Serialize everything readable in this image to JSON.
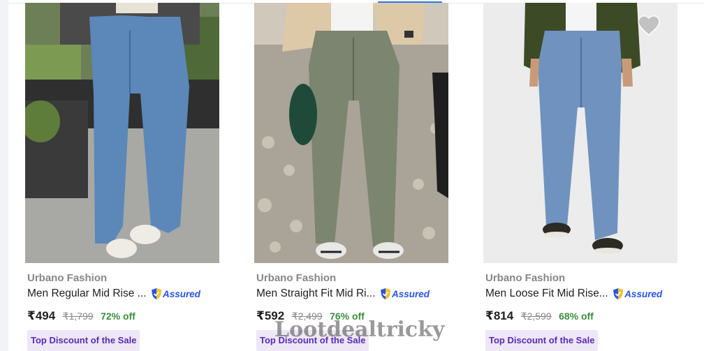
{
  "products": [
    {
      "brand": "Urbano Fashion",
      "title": "Men Regular Mid Rise ...",
      "assured_label": "Assured",
      "price": "₹494",
      "mrp": "₹1,799",
      "discount": "72% off",
      "badge": "Top Discount of the Sale",
      "icons": {
        "wishlist": "heart-icon",
        "assured": "shield-check-icon"
      }
    },
    {
      "brand": "Urbano Fashion",
      "title": "Men Straight Fit Mid Ri...",
      "assured_label": "Assured",
      "price": "₹592",
      "mrp": "₹2,499",
      "discount": "76% off",
      "badge": "Top Discount of the Sale",
      "icons": {
        "wishlist": "heart-icon",
        "assured": "shield-check-icon"
      }
    },
    {
      "brand": "Urbano Fashion",
      "title": "Men Loose Fit Mid Rise...",
      "assured_label": "Assured",
      "price": "₹814",
      "mrp": "₹2,599",
      "discount": "68% off",
      "badge": "Top Discount of the Sale",
      "icons": {
        "wishlist": "heart-icon",
        "assured": "shield-check-icon"
      }
    }
  ],
  "watermark": "Lootdealtricky",
  "colors": {
    "discount_green": "#388e3c",
    "assured_blue": "#2a55e5",
    "badge_bg": "#ede7f6",
    "badge_text": "#5a2ab5",
    "accent_blue": "#2874f0"
  }
}
